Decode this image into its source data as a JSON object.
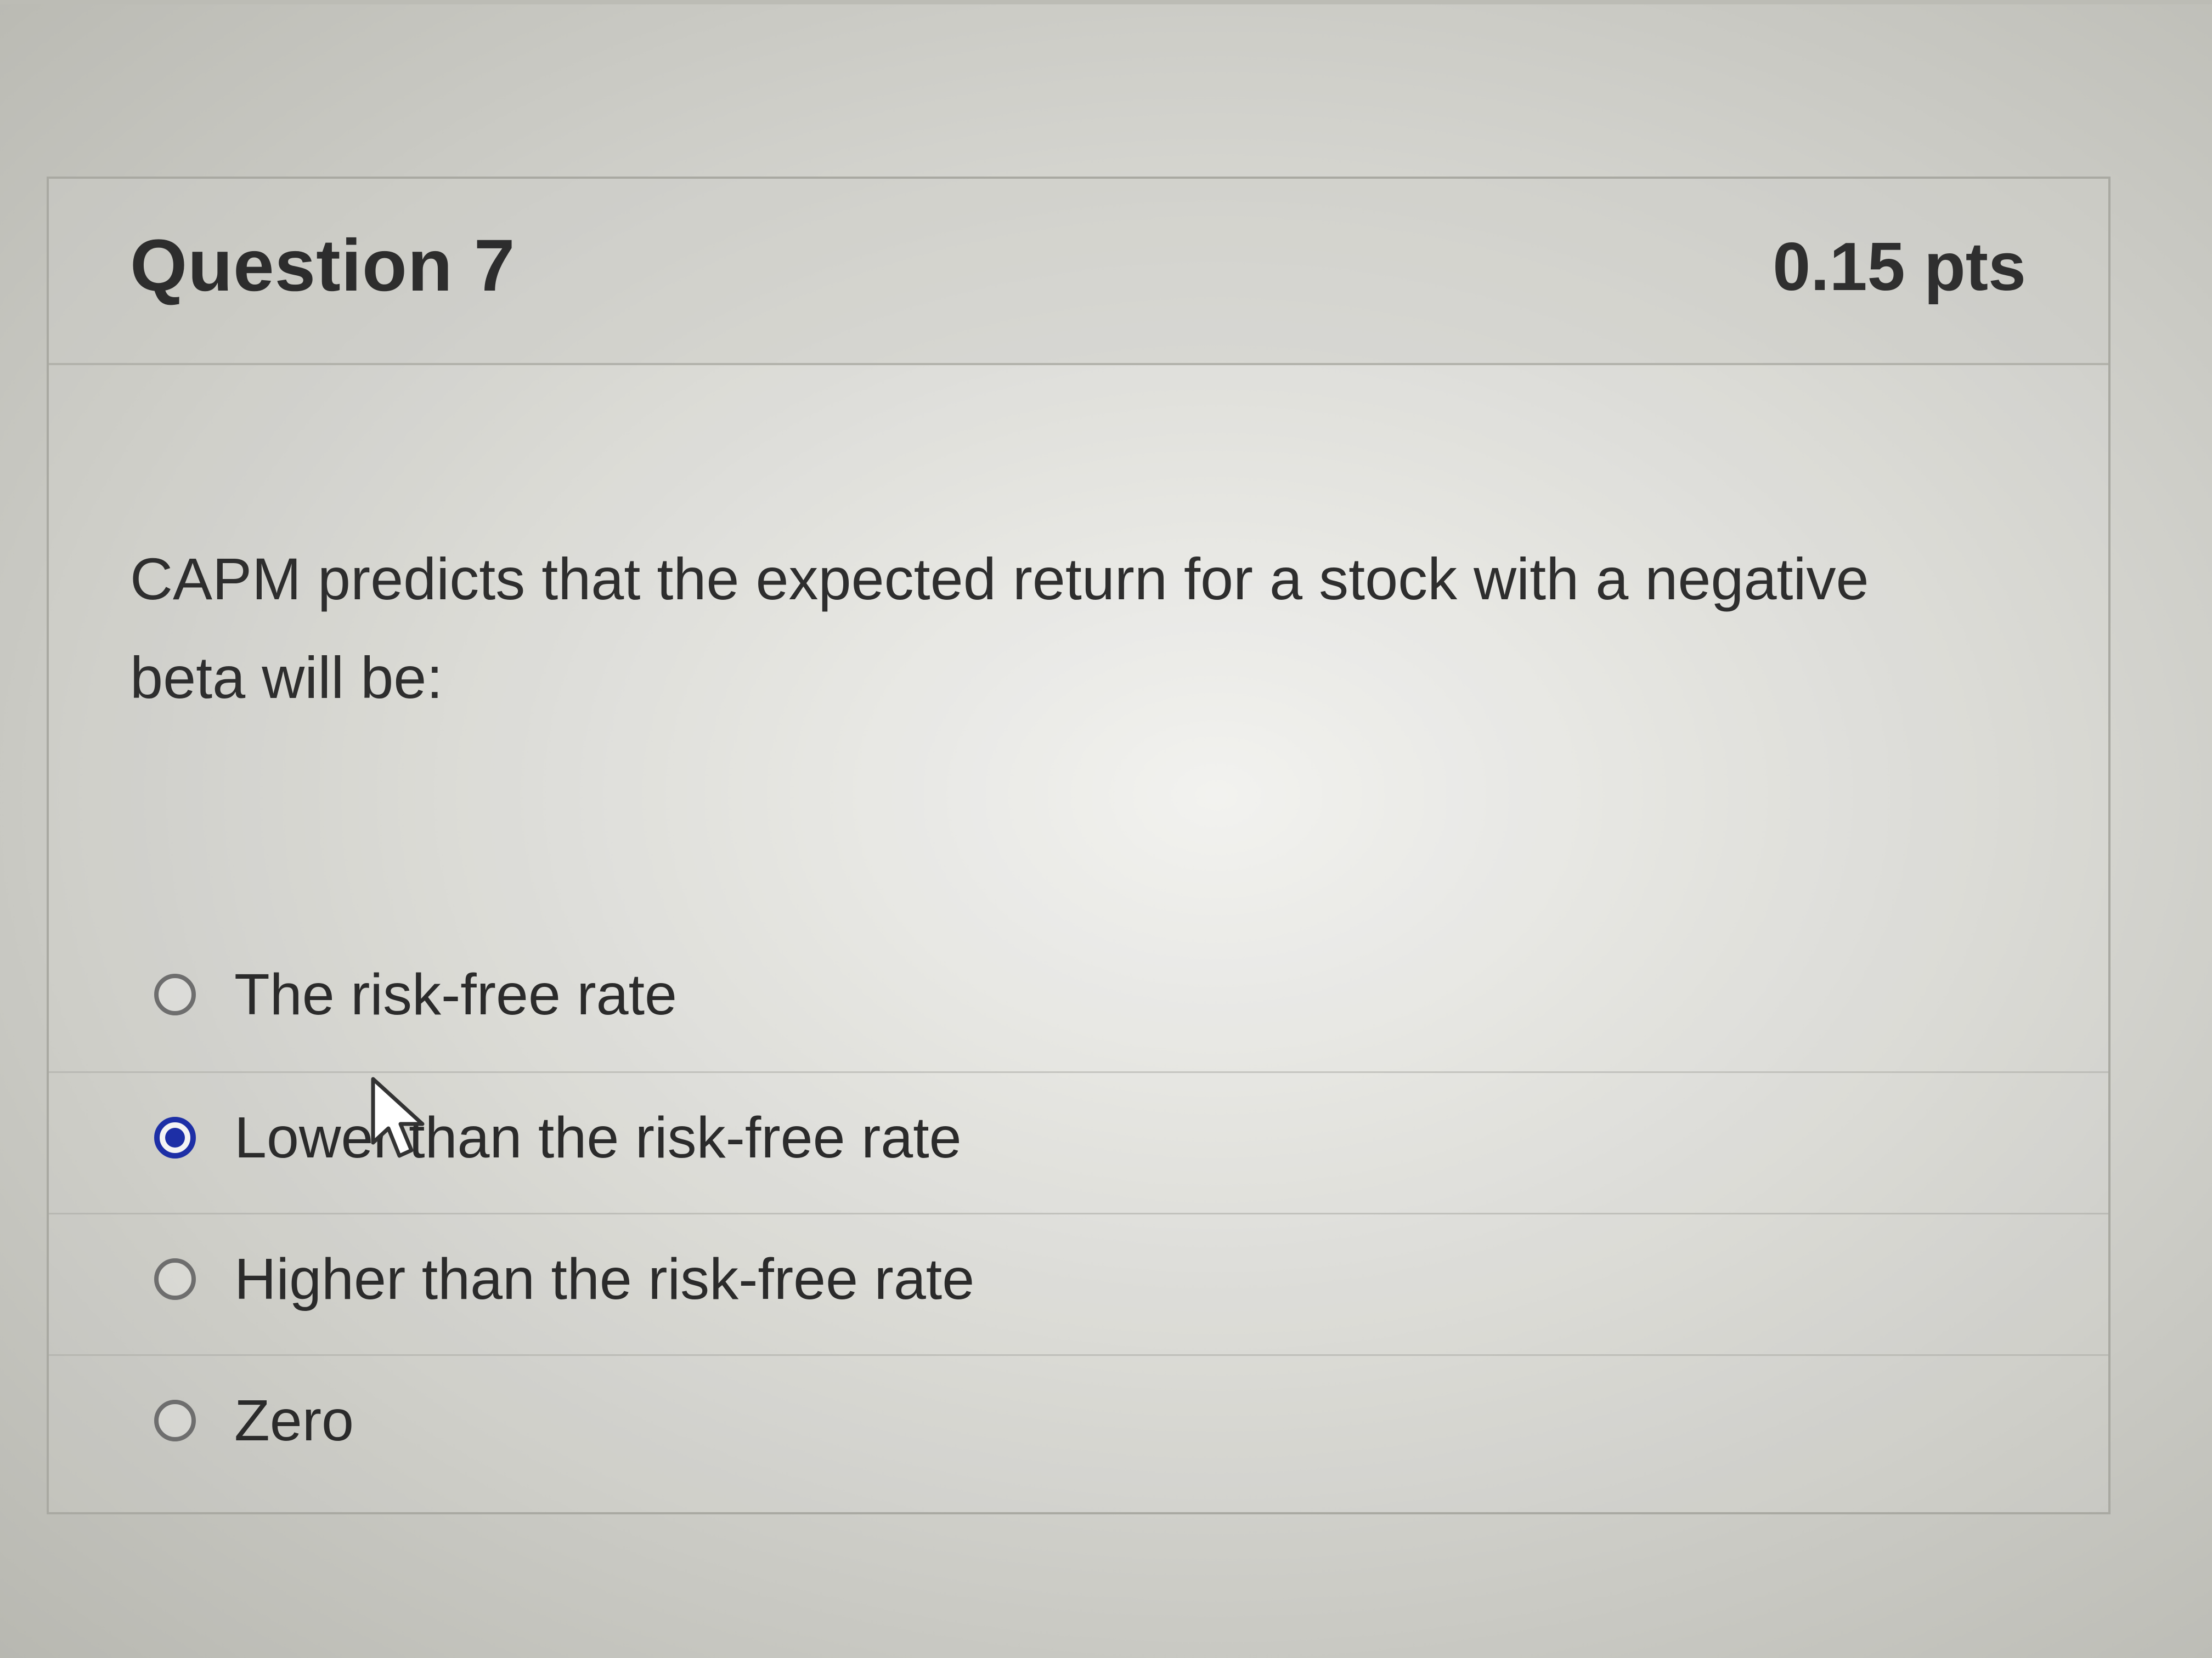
{
  "question": {
    "title": "Question 7",
    "points": "0.15 pts",
    "text": "CAPM predicts that the expected return for a stock with a negative beta will be:"
  },
  "answers": [
    {
      "label": "The risk-free rate",
      "selected": false
    },
    {
      "label": "Lower than the risk-free rate",
      "selected": true
    },
    {
      "label": "Higher than the risk-free rate",
      "selected": false
    },
    {
      "label": "Zero",
      "selected": false
    }
  ],
  "colors": {
    "selected_radio": "#1d2fa6",
    "text": "#2d2d2d",
    "border": "#a9a9a2"
  }
}
